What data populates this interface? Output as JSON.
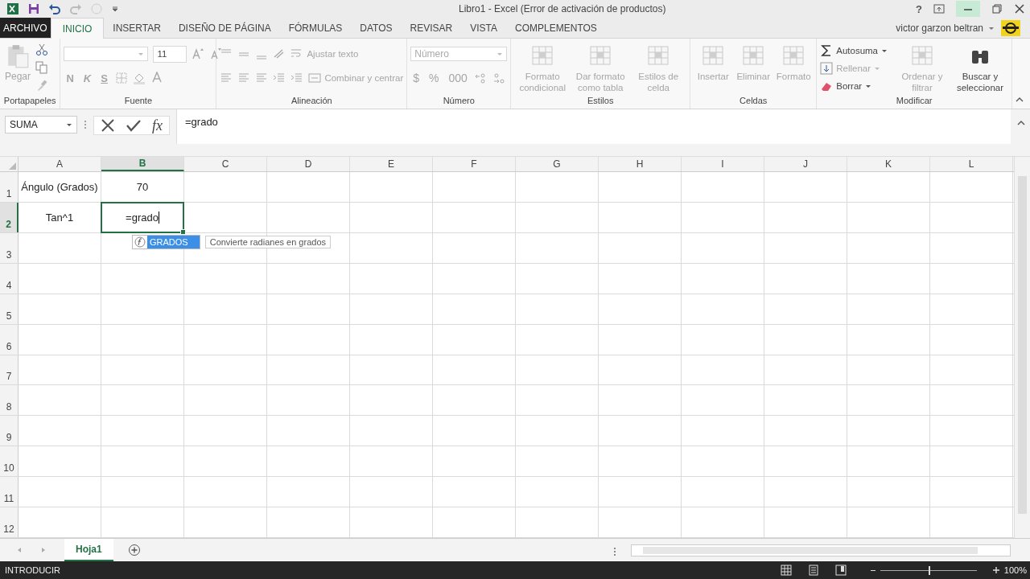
{
  "title_bar": {
    "title": "Libro1 - Excel (Error de activación de productos)",
    "help": "?"
  },
  "ribbon_tabs": [
    {
      "label": "ARCHIVO",
      "kind": "file",
      "selected": false
    },
    {
      "label": "INICIO",
      "kind": "tab",
      "selected": true
    },
    {
      "label": "INSERTAR",
      "kind": "tab",
      "selected": false
    },
    {
      "label": "DISEÑO DE PÁGINA",
      "kind": "tab",
      "selected": false
    },
    {
      "label": "FÓRMULAS",
      "kind": "tab",
      "selected": false
    },
    {
      "label": "DATOS",
      "kind": "tab",
      "selected": false
    },
    {
      "label": "REVISAR",
      "kind": "tab",
      "selected": false
    },
    {
      "label": "VISTA",
      "kind": "tab",
      "selected": false
    },
    {
      "label": "COMPLEMENTOS",
      "kind": "tab",
      "selected": false
    }
  ],
  "account": {
    "user": "victor garzon beltran"
  },
  "ribbon_groups": [
    {
      "kind": "clipboard",
      "label": "Portapapeles",
      "items": [
        {
          "label": "Pegar",
          "disabled": true
        }
      ]
    },
    {
      "kind": "font",
      "label": "Fuente",
      "font_size": "11",
      "items": [
        {
          "label": "N",
          "disabled": true
        },
        {
          "label": "K",
          "disabled": true
        },
        {
          "label": "S",
          "disabled": true
        }
      ]
    },
    {
      "kind": "alignment",
      "label": "Alineación",
      "items": [
        {
          "label": "Ajustar texto",
          "disabled": true
        },
        {
          "label": "Combinar y centrar",
          "disabled": true
        }
      ]
    },
    {
      "kind": "number",
      "label": "Número",
      "format": "Número",
      "items": [
        {
          "label": "$",
          "disabled": true
        },
        {
          "label": "%",
          "disabled": true
        },
        {
          "label": "000",
          "disabled": true
        }
      ]
    },
    {
      "kind": "buttons",
      "label": "Estilos",
      "items": [
        {
          "label": "Formato condicional",
          "kind": "large",
          "disabled": true
        },
        {
          "label": "Dar formato como tabla",
          "kind": "large",
          "disabled": true
        },
        {
          "label": "Estilos de celda",
          "kind": "large",
          "disabled": true
        }
      ]
    },
    {
      "kind": "buttons",
      "label": "Celdas",
      "items": [
        {
          "label": "Insertar",
          "kind": "large",
          "disabled": true
        },
        {
          "label": "Eliminar",
          "kind": "large",
          "disabled": true
        },
        {
          "label": "Formato",
          "kind": "large",
          "disabled": true
        }
      ]
    },
    {
      "kind": "buttons",
      "label": "Modificar",
      "items": [
        {
          "label": "Autosuma",
          "kind": "small",
          "disabled": false
        },
        {
          "label": "Rellenar",
          "kind": "small",
          "disabled": true
        },
        {
          "label": "Borrar",
          "kind": "small",
          "disabled": false
        },
        {
          "label": "Ordenar y filtrar",
          "kind": "large",
          "disabled": true
        },
        {
          "label": "Buscar y seleccionar",
          "kind": "large",
          "disabled": false
        }
      ]
    }
  ],
  "formula_bar": {
    "name_box": "SUMA",
    "function_label": "fx",
    "formula": "=grado"
  },
  "columns": [
    {
      "label": "A",
      "selected": false
    },
    {
      "label": "B",
      "selected": true
    },
    {
      "label": "C",
      "selected": false
    },
    {
      "label": "D",
      "selected": false
    },
    {
      "label": "E",
      "selected": false
    },
    {
      "label": "F",
      "selected": false
    },
    {
      "label": "G",
      "selected": false
    },
    {
      "label": "H",
      "selected": false
    },
    {
      "label": "I",
      "selected": false
    },
    {
      "label": "J",
      "selected": false
    },
    {
      "label": "K",
      "selected": false
    },
    {
      "label": "L",
      "selected": false
    }
  ],
  "rows": [
    {
      "label": "1",
      "selected": false,
      "cells": [
        {
          "text": "Ángulo (Grados)",
          "editing": false
        },
        {
          "text": "70",
          "editing": false
        }
      ]
    },
    {
      "label": "2",
      "selected": true,
      "cells": [
        {
          "text": "Tan^1",
          "editing": false
        },
        {
          "text": "=grado",
          "editing": true
        }
      ]
    },
    {
      "label": "3",
      "selected": false
    },
    {
      "label": "4",
      "selected": false
    },
    {
      "label": "5",
      "selected": false
    },
    {
      "label": "6",
      "selected": false
    },
    {
      "label": "7",
      "selected": false
    },
    {
      "label": "8",
      "selected": false
    },
    {
      "label": "9",
      "selected": false
    },
    {
      "label": "10",
      "selected": false
    },
    {
      "label": "11",
      "selected": false
    },
    {
      "label": "12",
      "selected": false
    }
  ],
  "autocomplete": {
    "items": [
      {
        "label": "GRADOS",
        "selected": true
      }
    ],
    "tooltip": "Convierte radianes en grados"
  },
  "sheet_tabs": [
    {
      "label": "Hoja1",
      "selected": true
    }
  ],
  "status_bar": {
    "mode": "INTRODUCIR",
    "zoom": {
      "level": 0.5
    },
    "zoom_label": "100%"
  }
}
